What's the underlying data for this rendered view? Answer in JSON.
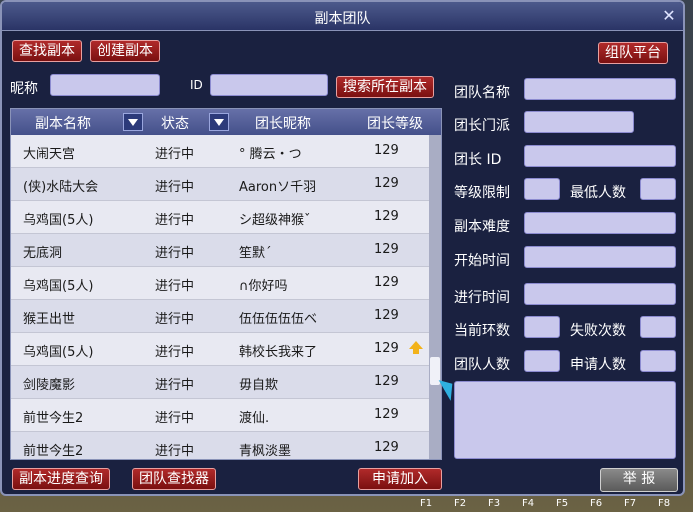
{
  "window": {
    "title": "副本团队"
  },
  "top_buttons": {
    "find": "查找副本",
    "create": "创建副本",
    "platform": "组队平台"
  },
  "search": {
    "nickname_label": "昵称",
    "id_label": "ID",
    "search_button": "搜索所在副本"
  },
  "table": {
    "headers": [
      "副本名称",
      "状态",
      "团长昵称",
      "团长等级"
    ],
    "rows": [
      [
        "大闹天宫",
        "进行中",
        "° 腾云・つ",
        "129"
      ],
      [
        "(侠)水陆大会",
        "进行中",
        "Aaronソ千羽",
        "129"
      ],
      [
        "乌鸡国(5人)",
        "进行中",
        "シ超级神猴ˇ",
        "129"
      ],
      [
        "无底洞",
        "进行中",
        "笙默ˊ",
        "129"
      ],
      [
        "乌鸡国(5人)",
        "进行中",
        "∩你好吗",
        "129"
      ],
      [
        "猴王出世",
        "进行中",
        "伍伍伍伍伍ベ",
        "129"
      ],
      [
        "乌鸡国(5人)",
        "进行中",
        "韩校长我来了",
        "129"
      ],
      [
        "剑陵魔影",
        "进行中",
        "毋自欺",
        "129"
      ],
      [
        "前世今生2",
        "进行中",
        "渡仙.",
        "129"
      ],
      [
        "前世今生2",
        "进行中",
        "青枫淡墨",
        "129"
      ]
    ]
  },
  "right_panel": {
    "team_name": "团队名称",
    "leader_sect": "团长门派",
    "leader_id": "团长  ID",
    "level_limit": "等级限制",
    "min_people": "最低人数",
    "difficulty": "副本难度",
    "start_time": "开始时间",
    "progress_time": "进行时间",
    "current_round": "当前环数",
    "fail_count": "失败次数",
    "team_count": "团队人数",
    "apply_count": "申请人数"
  },
  "bottom_buttons": {
    "progress_query": "副本进度查询",
    "team_finder": "团队查找器",
    "apply_join": "申请加入",
    "report": "举 报"
  },
  "bottom_strip": [
    "F1",
    "F2",
    "F3",
    "F4",
    "F5",
    "F6",
    "F7",
    "F8"
  ],
  "colors": {
    "window_bg": "#1a2140",
    "button_red": "#b02a2a",
    "input_bg": "#c9c8ec"
  }
}
